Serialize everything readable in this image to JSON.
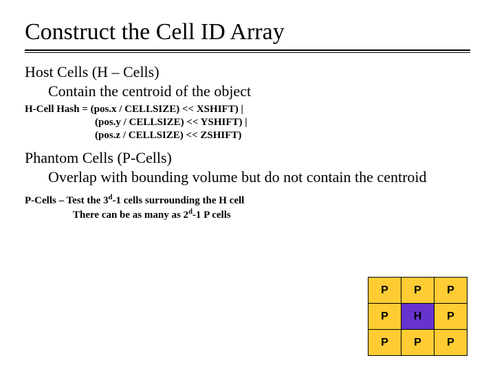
{
  "title": "Construct the Cell ID Array",
  "section1": {
    "heading": "Host Cells (H – Cells)",
    "line": "Contain the centroid of the object",
    "hash": {
      "l1": "H-Cell Hash = (pos.x / CELLSIZE) << XSHIFT) |",
      "l2": "(pos.y / CELLSIZE) << YSHIFT) |",
      "l3": "(pos.z / CELLSIZE) << ZSHIFT)"
    }
  },
  "section2": {
    "heading": "Phantom Cells (P-Cells)",
    "line": "Overlap with bounding volume but do not contain the centroid",
    "pnote_a": "P-Cells – Test the 3",
    "pnote_b": "-1 cells surrounding the H cell",
    "pnote2a": "There can be as many as 2",
    "pnote2b": "-1 P cells",
    "sup": "d"
  },
  "grid": {
    "r0": [
      "P",
      "P",
      "P"
    ],
    "r1": [
      "P",
      "H",
      "P"
    ],
    "r2": [
      "P",
      "P",
      "P"
    ]
  }
}
